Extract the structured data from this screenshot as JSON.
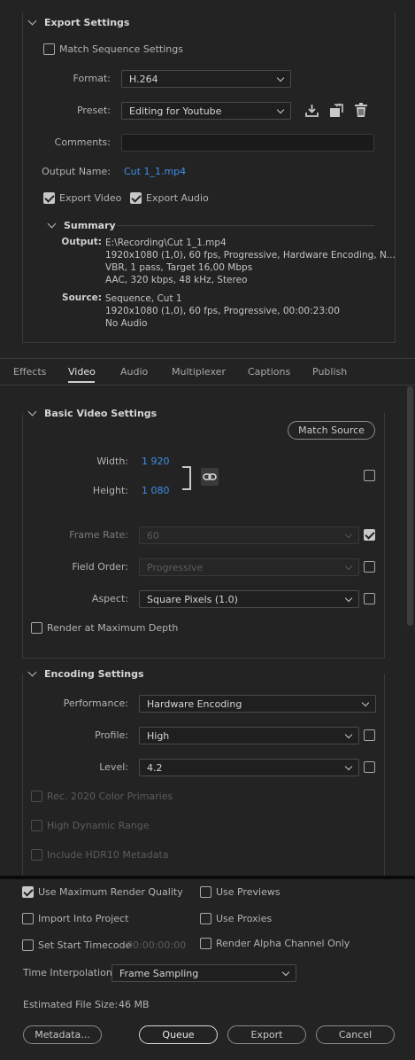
{
  "export_settings": {
    "title": "Export Settings",
    "match_sequence_label": "Match Sequence Settings",
    "match_sequence_checked": false,
    "format_label": "Format:",
    "format_value": "H.264",
    "preset_label": "Preset:",
    "preset_value": "Editing for Youtube",
    "comments_label": "Comments:",
    "comments_value": "",
    "output_name_label": "Output Name:",
    "output_name_value": "Cut 1_1.mp4",
    "export_video_label": "Export Video",
    "export_video_checked": true,
    "export_audio_label": "Export Audio",
    "export_audio_checked": true
  },
  "summary": {
    "title": "Summary",
    "output_label": "Output:",
    "output_lines": [
      "E:\\Recording\\Cut 1_1.mp4",
      "1920x1080 (1,0), 60 fps, Progressive, Hardware Encoding, N...",
      "VBR, 1 pass, Target 16,00 Mbps",
      "AAC, 320 kbps, 48 kHz, Stereo"
    ],
    "source_label": "Source:",
    "source_lines": [
      "Sequence, Cut 1",
      "1920x1080 (1,0), 60 fps, Progressive, 00:00:23:00",
      "No Audio"
    ]
  },
  "tabs": [
    "Effects",
    "Video",
    "Audio",
    "Multiplexer",
    "Captions",
    "Publish"
  ],
  "active_tab": "Video",
  "basic_video": {
    "title": "Basic Video Settings",
    "match_source_label": "Match Source",
    "width_label": "Width:",
    "width_value": "1 920",
    "height_label": "Height:",
    "height_value": "1 080",
    "frame_rate_label": "Frame Rate:",
    "frame_rate_value": "60",
    "field_order_label": "Field Order:",
    "field_order_value": "Progressive",
    "aspect_label": "Aspect:",
    "aspect_value": "Square Pixels (1.0)",
    "render_max_depth_label": "Render at Maximum Depth"
  },
  "encoding": {
    "title": "Encoding Settings",
    "performance_label": "Performance:",
    "performance_value": "Hardware Encoding",
    "profile_label": "Profile:",
    "profile_value": "High",
    "level_label": "Level:",
    "level_value": "4.2",
    "rec2020_label": "Rec. 2020 Color Primaries",
    "hdr_label": "High Dynamic Range",
    "hdr10_label": "Include HDR10 Metadata"
  },
  "bottom": {
    "use_max_quality_label": "Use Maximum Render Quality",
    "use_max_quality_checked": true,
    "use_previews_label": "Use Previews",
    "import_project_label": "Import Into Project",
    "use_proxies_label": "Use Proxies",
    "start_timecode_label": "Set Start Timecode",
    "start_timecode_value": "00:00:00:00",
    "alpha_only_label": "Render Alpha Channel Only",
    "time_interp_label": "Time Interpolation:",
    "time_interp_value": "Frame Sampling",
    "est_size_label": "Estimated File Size:",
    "est_size_value": "46 MB",
    "metadata_btn": "Metadata...",
    "queue_btn": "Queue",
    "export_btn": "Export",
    "cancel_btn": "Cancel"
  }
}
